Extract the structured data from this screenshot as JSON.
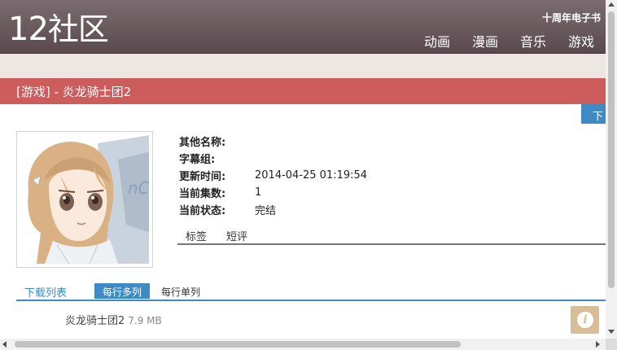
{
  "header": {
    "logo_num": "12",
    "logo_text": "社区",
    "tagline": "十周年电子书",
    "nav": [
      "动画",
      "漫画",
      "音乐",
      "游戏"
    ]
  },
  "title": "[游戏] - 炎龙骑士团2",
  "download_tab": "下",
  "info": {
    "rows": [
      {
        "label": "其他名称:",
        "value": ""
      },
      {
        "label": "字幕组:",
        "value": ""
      },
      {
        "label": "更新时间:",
        "value": "2014-04-25 01:19:54"
      },
      {
        "label": "当前集数:",
        "value": "1"
      },
      {
        "label": "当前状态:",
        "value": "完结"
      }
    ],
    "tabs": [
      "标签",
      "短评"
    ]
  },
  "download_list": {
    "title": "下载列表",
    "multi_label": "每行多列",
    "single_label": "每行单列",
    "files": [
      {
        "name": "炎龙骑士团2",
        "size": "7.9 MB"
      }
    ]
  },
  "icons": {
    "info": "info-icon",
    "info_glyph": "i"
  },
  "colors": {
    "header": "#6a5b60",
    "title_bar": "#cd5c5c",
    "accent": "#3f8ac3",
    "info_button": "#d9bd98"
  }
}
